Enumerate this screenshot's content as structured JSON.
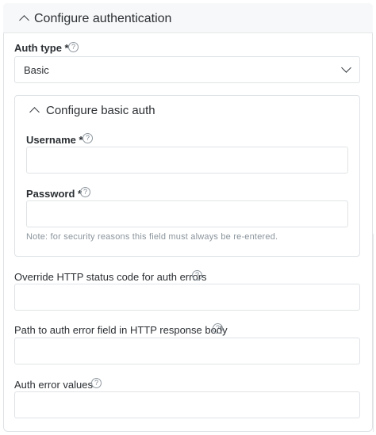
{
  "header": {
    "title": "Configure authentication"
  },
  "auth_type": {
    "label": "Auth type *",
    "value": "Basic",
    "help": "?"
  },
  "basic_auth": {
    "title": "Configure basic auth",
    "username": {
      "label": "Username *",
      "value": "",
      "help": "?"
    },
    "password": {
      "label": "Password *",
      "value": "",
      "help": "?"
    },
    "note": "Note: for security reasons this field must always be re-entered."
  },
  "override_status": {
    "label": "Override HTTP status code for auth errors",
    "value": "",
    "help": "?"
  },
  "error_path": {
    "label": "Path to auth error field in HTTP response body",
    "value": "",
    "help": "?"
  },
  "error_values": {
    "label": "Auth error values",
    "value": "",
    "help": "?"
  },
  "icons": {
    "collapse": "chevron-up-icon",
    "dropdown": "chevron-down-icon",
    "help": "help-circle-icon"
  }
}
